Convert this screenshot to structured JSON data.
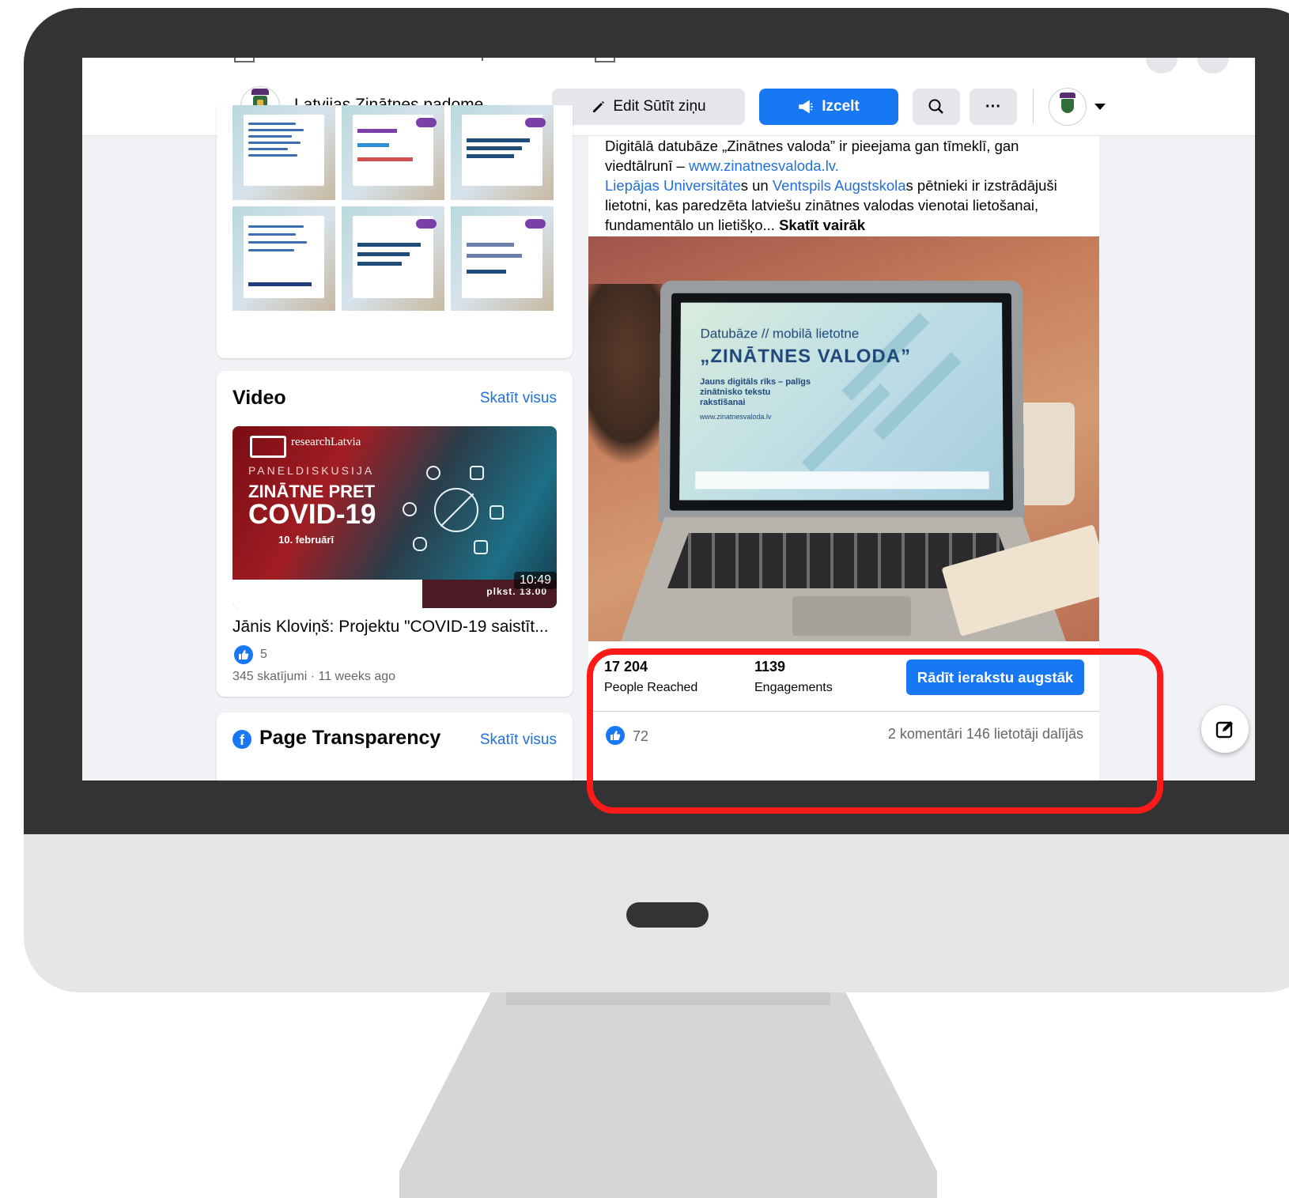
{
  "header": {
    "page_name": "Latvijas Zinātnes padome",
    "edit_label": "Edit Sūtīt ziņu",
    "boost_label": "Izcelt"
  },
  "video_section": {
    "title": "Video",
    "see_all": "Skatīt visus",
    "thumb_brand": "researchLatvia",
    "thumb_line_1": "PANELDISKUSIJA",
    "thumb_line_2": "ZINĀTNE PRET",
    "thumb_line_3": "COVID-19",
    "thumb_line_4": "10. februārī",
    "thumb_time": "plkst. 13.00",
    "duration": "10:49",
    "video_title": "Jānis Kloviņš: Projektu \"COVID-19 saistīt...",
    "likes": "5",
    "meta": "345 skatījumi · 11 weeks ago"
  },
  "transparency": {
    "title": "Page Transparency",
    "see_all": "Skatīt visus"
  },
  "post": {
    "text_1": "Digitālā datubāze „Zinātnes valoda” ir pieejama gan tīmeklī, gan viedtālrunī – ",
    "link_1": "www.zinatnesvaloda.lv.",
    "link_2": "Liepājas Universitāte",
    "text_2": "s un ",
    "link_3": "Ventspils Augstskola",
    "text_3": "s pētnieki ir izstrādājuši lietotni, kas paredzēta latviešu zinātnes valodas vienotai lietošanai, fundamentālo un lietišķo... ",
    "see_more": "Skatīt vairāk",
    "slide_title_1": "Datubāze // mobilā lietotne",
    "slide_title_2": "„ZINĀTNES VALODA”",
    "slide_sub": "Jauns digitāls rīks – palīgs zinātnisko tekstu rakstīšanai",
    "slide_url": "www.zinatnesvaloda.lv",
    "reached_value": "17 204",
    "reached_label": "People Reached",
    "engagements_value": "1139",
    "engagements_label": "Engagements",
    "boost_post_label": "Rādīt ierakstu augstāk",
    "reactions": "72",
    "comments_shares": "2 komentāri  146 lietotāji dalījās"
  },
  "colors": {
    "accent": "#1877f2",
    "highlight": "#ff1a1a",
    "bezel": "#333333",
    "link": "#216fdb"
  },
  "icons": [
    "pencil-icon",
    "megaphone-icon",
    "search-icon",
    "more-icon",
    "caret-down-icon",
    "like-icon",
    "facebook-icon",
    "compose-icon"
  ]
}
